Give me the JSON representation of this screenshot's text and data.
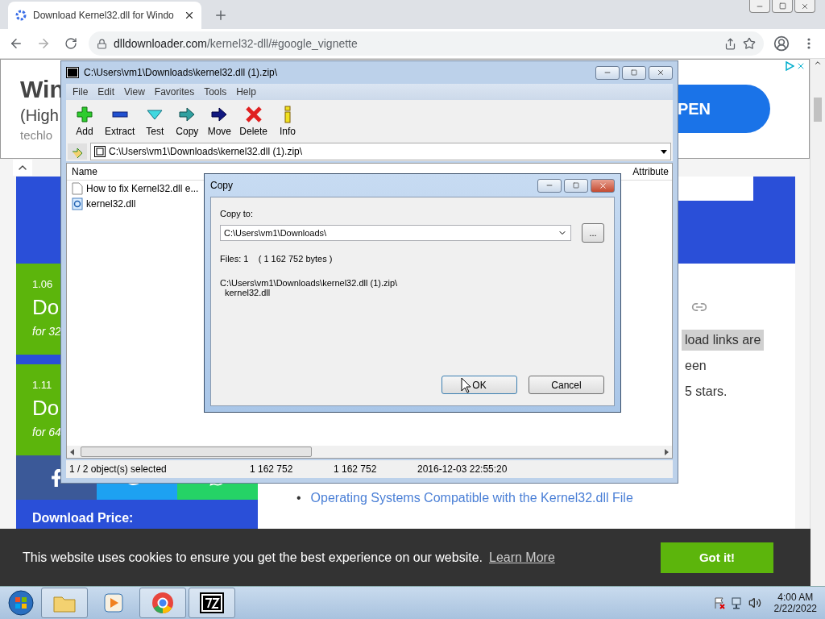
{
  "browser": {
    "tab_title": "Download Kernel32.dll for Windo",
    "url_host": "dlldownloader.com",
    "url_path": "/kernel32-dll/#google_vignette"
  },
  "page": {
    "ad_lines": [
      "Win",
      "(High",
      "techlo"
    ],
    "ad_button": "PEN",
    "cards": [
      {
        "size": "1.06",
        "title": "Do",
        "sub": "for 32"
      },
      {
        "size": "1.11",
        "title": "Do",
        "sub": "for 64"
      }
    ],
    "price_label": "Download Price:",
    "text_lines": [
      {
        "text": "load links are",
        "highlighted": true
      },
      {
        "text": "een",
        "highlighted": false
      },
      {
        "text": "5 stars.",
        "highlighted": false
      }
    ],
    "links": [
      {
        "bullet": "•",
        "text": "Operating Systems Compatible with the Kernel32.dll File"
      }
    ]
  },
  "cookie": {
    "text": "This website uses cookies to ensure you get the best experience on our website.",
    "link": "Learn More",
    "button": "Got it!"
  },
  "sevenzip": {
    "title": "C:\\Users\\vm1\\Downloads\\kernel32.dll (1).zip\\",
    "menu": [
      "File",
      "Edit",
      "View",
      "Favorites",
      "Tools",
      "Help"
    ],
    "toolbar": [
      {
        "label": "Add",
        "kind": "add"
      },
      {
        "label": "Extract",
        "kind": "extract"
      },
      {
        "label": "Test",
        "kind": "test"
      },
      {
        "label": "Copy",
        "kind": "copy"
      },
      {
        "label": "Move",
        "kind": "move"
      },
      {
        "label": "Delete",
        "kind": "delete"
      },
      {
        "label": "Info",
        "kind": "info"
      }
    ],
    "path": "C:\\Users\\vm1\\Downloads\\kernel32.dll (1).zip\\",
    "columns": [
      "Name",
      "Attribute"
    ],
    "files": [
      {
        "name": "How to fix Kernel32.dll e...",
        "kind": "text"
      },
      {
        "name": "kernel32.dll",
        "kind": "dll"
      }
    ],
    "status": [
      "1 / 2 object(s) selected",
      "1 162 752",
      "1 162 752",
      "2016-12-03 22:55:20"
    ]
  },
  "dialog": {
    "title": "Copy",
    "copy_to_label": "Copy to:",
    "destination": "C:\\Users\\vm1\\Downloads\\",
    "browse": "...",
    "files_info": "Files: 1    ( 1 162 752 bytes )",
    "source": [
      "C:\\Users\\vm1\\Downloads\\kernel32.dll (1).zip\\",
      "kernel32.dll"
    ],
    "ok": "OK",
    "cancel": "Cancel"
  },
  "taskbar": {
    "apps": [
      {
        "kind": "explorer",
        "running": true
      },
      {
        "kind": "media",
        "running": false
      },
      {
        "kind": "chrome",
        "running": true
      },
      {
        "kind": "sevenzip",
        "running": true
      }
    ],
    "time": "4:00 AM",
    "date": "2/22/2022"
  }
}
